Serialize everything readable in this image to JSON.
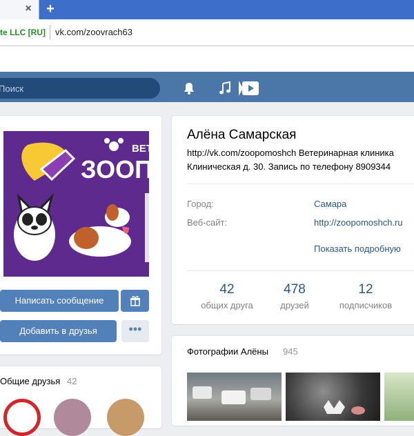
{
  "browser": {
    "new_tab_symbol": "+",
    "close_symbol": "×",
    "cert_label": "te LLC [RU]",
    "url": "vk.com/zoovrach63"
  },
  "header": {
    "search_placeholder": "Поиск",
    "accent_color": "#4a76a8",
    "icons": [
      "search-icon",
      "bell-icon",
      "music-note-icon",
      "play-icon"
    ]
  },
  "profile": {
    "name": "Алёна Самарская",
    "status_line1": "http://vk.com/zoopomoshch Ветеринарная клиника",
    "status_line2": "Клиническая д. 30. Запись по телефону 8909344",
    "avatar_text_top": "ВЕТ",
    "avatar_text_logo": "ЗООП",
    "city_label": "Город:",
    "city_value": "Самара",
    "website_label": "Веб-сайт:",
    "website_value": "http://zoopomoshch.ru",
    "show_more": "Показать подробную",
    "counters": [
      {
        "value": "42",
        "label": "общих друга"
      },
      {
        "value": "478",
        "label": "друзей"
      },
      {
        "value": "12",
        "label": "подписчиков"
      }
    ]
  },
  "actions": {
    "message_label": "Написать сообщение",
    "add_friend_label": "Добавить в друзья",
    "more_label": "•••",
    "gift_icon": "gift-icon"
  },
  "mutual_friends": {
    "title": "Общие друзья",
    "count": "42"
  },
  "photos": {
    "title": "Фотографии Алёны",
    "count": "945"
  }
}
